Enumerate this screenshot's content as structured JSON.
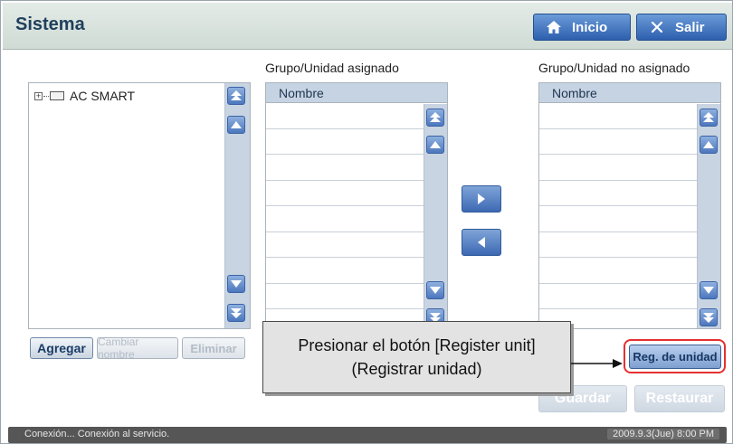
{
  "header": {
    "title": "Sistema",
    "home_label": "Inicio",
    "exit_label": "Salir"
  },
  "tree": {
    "root_label": "AC SMART"
  },
  "assigned": {
    "title": "Grupo/Unidad asignado",
    "column": "Nombre"
  },
  "unassigned": {
    "title": "Grupo/Unidad no asignado",
    "column": "Nombre"
  },
  "buttons": {
    "add": "Agregar",
    "rename": "Cambiar nombre",
    "delete": "Eliminar",
    "register_unit": "Reg. de unidad",
    "save": "Guardar",
    "restore": "Restaurar"
  },
  "callout": {
    "line1": "Presionar el botón [Register unit]",
    "line2": "(Registrar unidad)"
  },
  "status": {
    "message": "Conexión... Conexión al servicio.",
    "datetime": "2009.9.3(Jue)  8:00 PM"
  },
  "colors": {
    "accent": "#2d5fae",
    "highlight": "#e53030"
  }
}
